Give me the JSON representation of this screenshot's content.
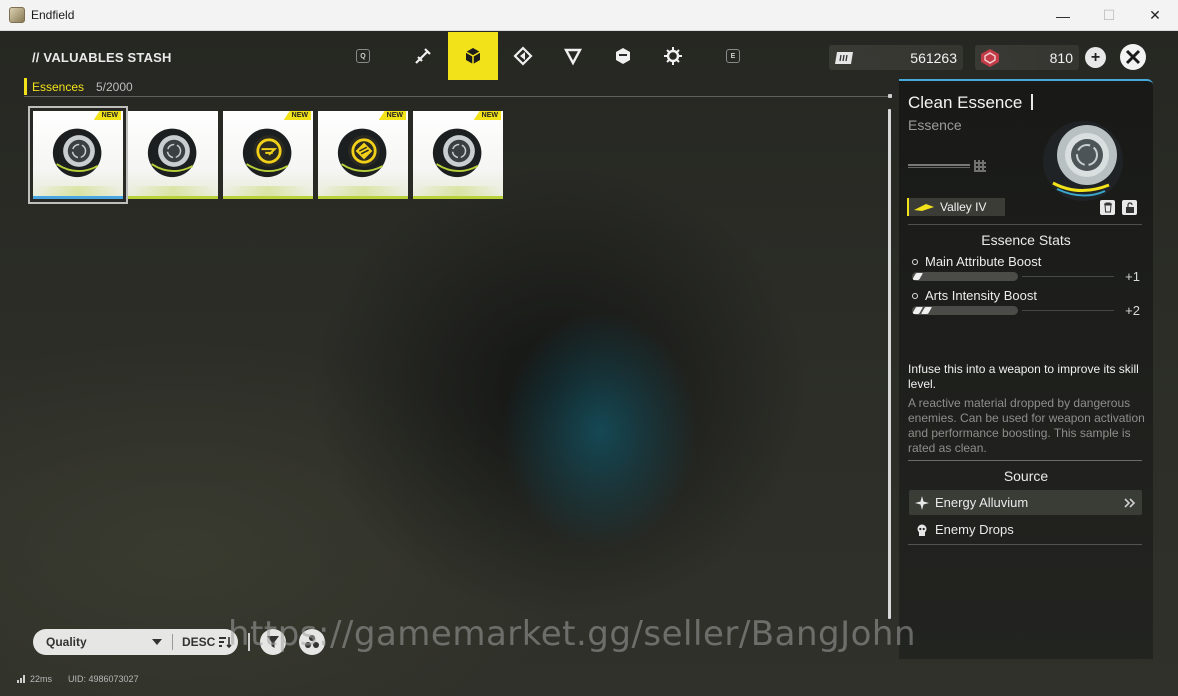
{
  "window": {
    "title": "Endfield",
    "controls": {
      "minimize": "—",
      "maximize": "☐",
      "close": "✕"
    }
  },
  "header": {
    "title": "// VALUABLES STASH",
    "key_left": "Q",
    "key_right": "E",
    "tabs": [
      {
        "icon": "weapon-icon",
        "active": false
      },
      {
        "icon": "cube-icon",
        "active": true
      },
      {
        "icon": "diamond-arrow-icon",
        "active": false
      },
      {
        "icon": "triangle-icon",
        "active": false
      },
      {
        "icon": "hexagon-box-icon",
        "active": false
      },
      {
        "icon": "gear-burst-icon",
        "active": false
      }
    ],
    "currency1": {
      "value": "561263",
      "icon": "ticket-icon"
    },
    "currency2": {
      "value": "810",
      "icon": "origeometry-icon"
    },
    "plus_label": "+"
  },
  "category": {
    "name": "Essences",
    "count": "5/2000"
  },
  "items": [
    {
      "badge": "NEW",
      "variant": "clean",
      "selected": true
    },
    {
      "badge": "",
      "variant": "clean",
      "selected": false
    },
    {
      "badge": "NEW",
      "variant": "gold-arrow",
      "selected": false
    },
    {
      "badge": "NEW",
      "variant": "gold-diamond",
      "selected": false
    },
    {
      "badge": "NEW",
      "variant": "clean",
      "selected": false
    }
  ],
  "detail": {
    "title": "Clean Essence",
    "subtitle": "Essence",
    "region_tag": "Valley IV",
    "stats_heading": "Essence Stats",
    "stats": [
      {
        "name": "Main Attribute Boost",
        "value": "+1",
        "pips": 1
      },
      {
        "name": "Arts Intensity Boost",
        "value": "+2",
        "pips": 2
      }
    ],
    "description": "Infuse this into a weapon to improve its skill level.",
    "flavor": "A reactive material dropped by dangerous enemies. Can be used for weapon activation and performance boosting. This sample is rated as clean.",
    "source_heading": "Source",
    "sources": [
      {
        "label": "Energy Alluvium",
        "icon": "sparkle-icon"
      },
      {
        "label": "Enemy Drops",
        "icon": "enemy-icon"
      }
    ]
  },
  "controls": {
    "sort_label": "Quality",
    "sort_dir": "DESC"
  },
  "watermark": "https://gamemarket.gg/seller/BangJohn",
  "status": {
    "ping": "22ms",
    "uid": "UID: 4986073027"
  },
  "colors": {
    "accent": "#f2e21a",
    "panel_top": "#47a9d9",
    "rarity": "#b9d23a"
  }
}
